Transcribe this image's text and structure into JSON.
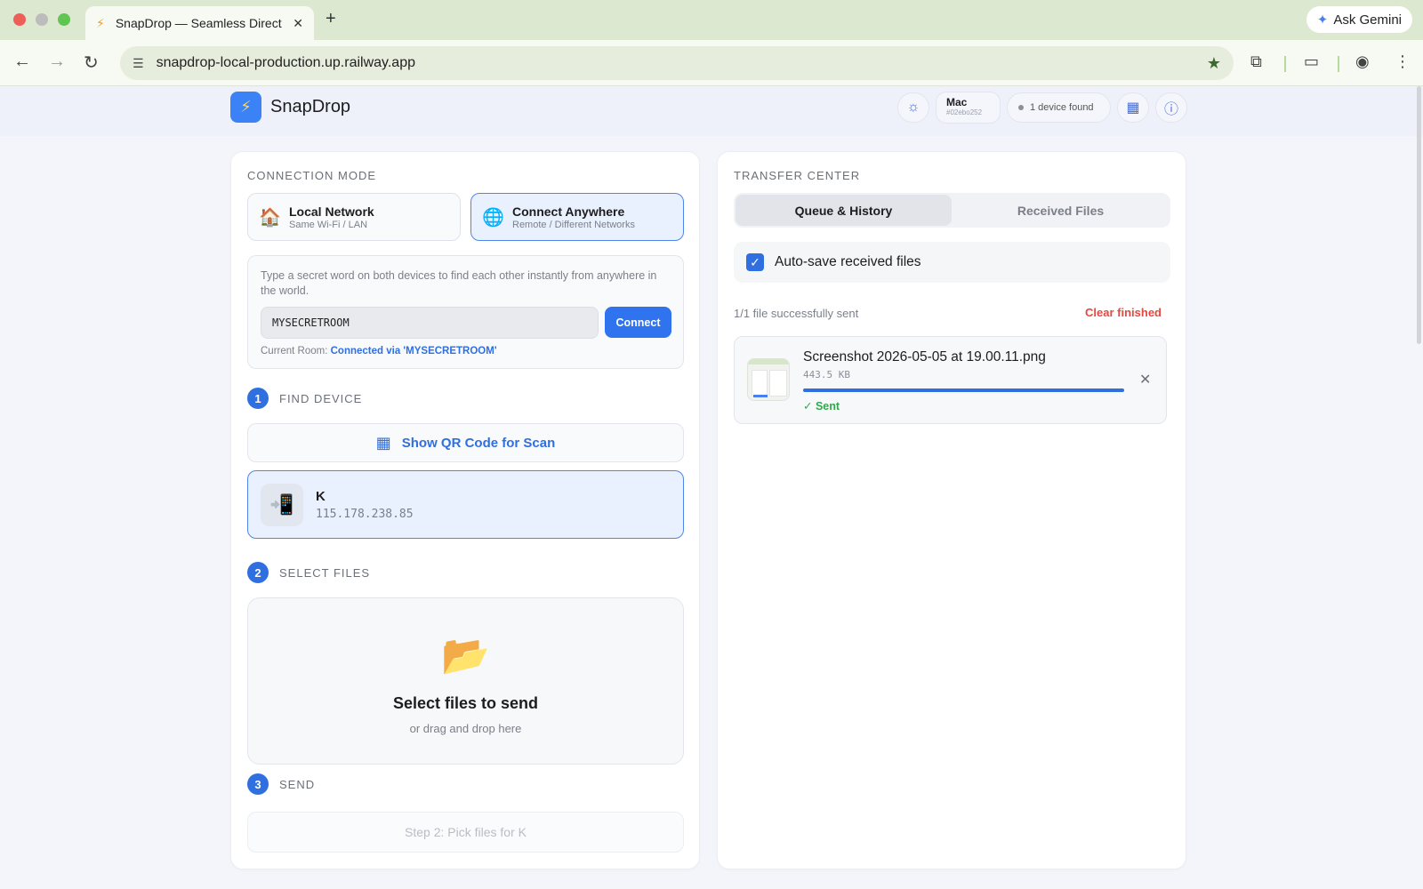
{
  "browser": {
    "tab_title": "SnapDrop — Seamless Direct",
    "new_tab": "+",
    "ask_gemini": "Ask Gemini",
    "url": "snapdrop-local-production.up.railway.app"
  },
  "header": {
    "app_name": "SnapDrop",
    "device_name": "Mac",
    "device_id": "#02ebo252",
    "device_count": "1 device found"
  },
  "connection": {
    "title": "CONNECTION MODE",
    "modes": [
      {
        "label": "Local Network",
        "sub": "Same Wi-Fi / LAN",
        "icon": "🏠"
      },
      {
        "label": "Connect Anywhere",
        "sub": "Remote / Different Networks",
        "icon": "🌐"
      }
    ],
    "description": "Type a secret word on both devices to find each other instantly from anywhere in the world.",
    "room_value": "MYSECRETROOM",
    "connect_label": "Connect",
    "current_room_label": "Current Room:",
    "current_room_value": "Connected via 'MYSECRETROOM'"
  },
  "steps": [
    {
      "num": "1",
      "label": "FIND DEVICE"
    },
    {
      "num": "2",
      "label": "SELECT FILES"
    },
    {
      "num": "3",
      "label": "SEND"
    }
  ],
  "find": {
    "qr_label": "Show QR Code for Scan",
    "peer_name": "K",
    "peer_ip": "115.178.238.85",
    "peer_icon": "📲"
  },
  "select": {
    "folder_icon": "📂",
    "title": "Select files to send",
    "subtitle": "or drag and drop here"
  },
  "send": {
    "label": "Step 2: Pick files for K"
  },
  "transfer": {
    "title": "TRANSFER CENTER",
    "tabs": [
      "Queue & History",
      "Received Files"
    ],
    "autosave_label": "Auto-save received files",
    "autosave_checked": true,
    "sent_count": "1/1 file successfully sent",
    "clear_label": "Clear finished",
    "files": [
      {
        "name": "Screenshot 2026-05-05 at 19.00.11.png",
        "size": "443.5 KB",
        "progress": 1.0,
        "status": "✓ Sent"
      }
    ]
  },
  "colors": {
    "accent": "#2f6fe0",
    "success": "#2eaa4a",
    "danger": "#e5483e"
  }
}
